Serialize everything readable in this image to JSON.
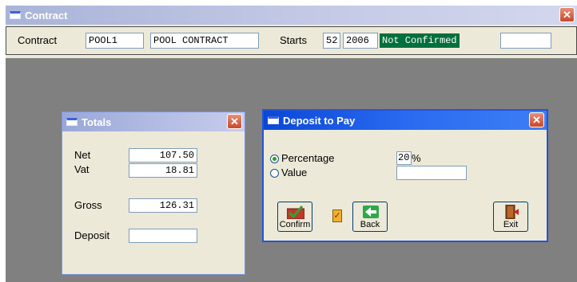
{
  "main_window": {
    "title": "Contract",
    "close_glyph": "✕",
    "contract_label": "Contract",
    "contract_code": "POOL1",
    "contract_name": "POOL CONTRACT",
    "starts_label": "Starts",
    "start_week": "52",
    "start_year": "2006",
    "status": "Not Confirmed",
    "extra_field": ""
  },
  "totals": {
    "title": "Totals",
    "close_glyph": "✕",
    "net_label": "Net",
    "net_value": "107.50",
    "vat_label": "Vat",
    "vat_value": "18.81",
    "gross_label": "Gross",
    "gross_value": "126.31",
    "deposit_label": "Deposit",
    "deposit_value": ""
  },
  "deposit_dialog": {
    "title": "Deposit to Pay",
    "close_glyph": "✕",
    "percentage_label": "Percentage",
    "percentage_value": "20",
    "percent_sign": "%",
    "value_label": "Value",
    "value_field": "",
    "selected_option": "Percentage",
    "confirm_label": "Confirm",
    "back_label": "Back",
    "exit_label": "Exit",
    "checkbox_glyph": "✓"
  },
  "colors": {
    "desktop": "#808080",
    "active_title": "#0a47d8",
    "inactive_title": "#a9b4d8",
    "status_bg": "#00703c"
  }
}
